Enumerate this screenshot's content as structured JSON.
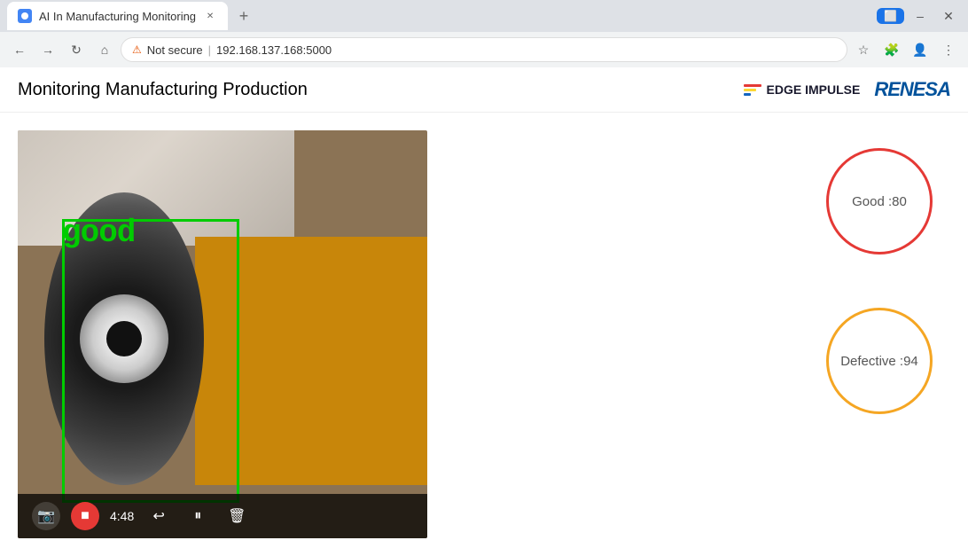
{
  "browser": {
    "tab_title": "AI In Manufacturing Monitoring",
    "address": "192.168.137.168:5000",
    "warning_text": "Not secure",
    "new_tab_symbol": "+",
    "back_symbol": "←",
    "forward_symbol": "→",
    "refresh_symbol": "↻",
    "home_symbol": "⌂"
  },
  "page": {
    "title": "Monitoring Manufacturing Production",
    "edge_impulse_label": "EDGE IMPULSE",
    "renesa_label": "RENESA"
  },
  "video": {
    "time": "4:48",
    "detection_label": "good"
  },
  "metrics": {
    "good": {
      "label": "Good :80",
      "border_color": "#e53935"
    },
    "defective": {
      "label": "Defective :94",
      "border_color": "#f5a623"
    }
  }
}
